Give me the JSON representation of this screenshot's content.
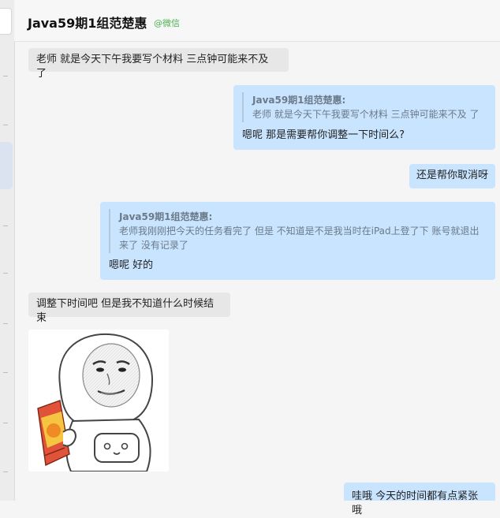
{
  "header": {
    "title": "Java59期1组范楚惠",
    "source": "@微信"
  },
  "messages": [
    {
      "side": "in",
      "text": "老师 就是今天下午我要写个材料 三点钟可能来不及 了"
    },
    {
      "side": "out",
      "quote_name": "Java59期1组范楚惠:",
      "quote_text": "老师 就是今天下午我要写个材料 三点钟可能来不及 了",
      "text": "嗯呢  那是需要帮你调整一下时间么?"
    },
    {
      "side": "out",
      "text": "还是帮你取消呀"
    },
    {
      "side": "out",
      "quote_name": "Java59期1组范楚惠:",
      "quote_text": "老师我刚刚把今天的任务看完了 但是 不知道是不是我当时在iPad上登了下 账号就退出来了 没有记录了",
      "text": "嗯呢 好的"
    },
    {
      "side": "in",
      "text": "调整下时间吧 但是我不知道什么时候结束"
    },
    {
      "side": "in",
      "image": "astronaut-meme-sticker"
    },
    {
      "side": "out",
      "text": "哇哦 今天的时间都有点紧张哦"
    }
  ],
  "colors": {
    "incoming_bubble": "#e7e7e7",
    "outgoing_bubble": "#c9e4ff",
    "source_tag": "#4caf50"
  }
}
